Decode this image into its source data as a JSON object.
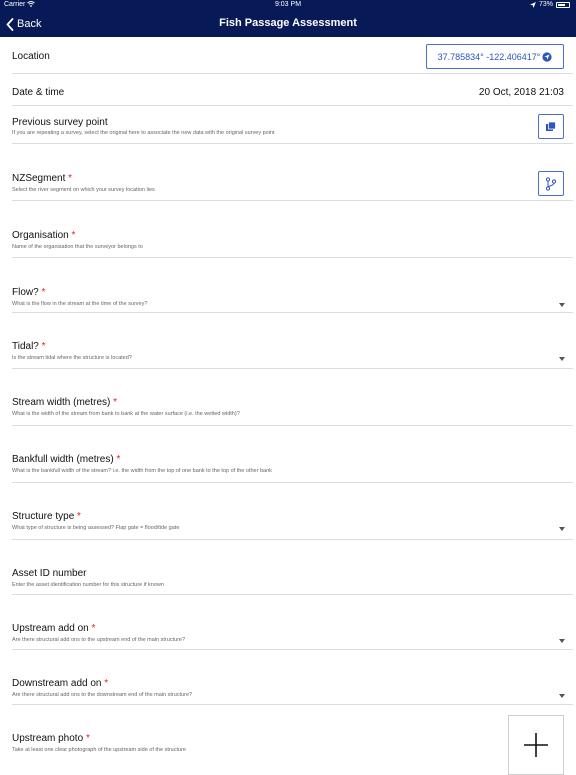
{
  "status_bar": {
    "carrier": "Carrier",
    "time": "9:03 PM",
    "battery": "73%"
  },
  "nav": {
    "back_label": "Back",
    "title": "Fish Passage Assessment"
  },
  "required_marker": "*",
  "fields": {
    "location": {
      "label": "Location",
      "value": "37.785834° -122.406417°"
    },
    "datetime": {
      "label": "Date & time",
      "value": "20 Oct, 2018 21:03"
    },
    "previous_survey": {
      "label": "Previous survey point",
      "help": "If you are repeating a survey, select the original here to associate the new data with the original survey point"
    },
    "nzsegment": {
      "label": "NZSegment",
      "help": "Select the river segment on which your survey location lies"
    },
    "organisation": {
      "label": "Organisation",
      "help": "Name of the organisation that the surveyor belongs to"
    },
    "flow": {
      "label": "Flow?",
      "help": "What is the flow in the stream at the time of the survey?"
    },
    "tidal": {
      "label": "Tidal?",
      "help": "Is the stream tidal where the structure is located?"
    },
    "stream_width": {
      "label": "Stream width (metres)",
      "help": "What is the width of the stream from bank to bank at the water surface (i.e. the wetted width)?"
    },
    "bankfull_width": {
      "label": "Bankfull width (metres)",
      "help": "What is the bankfull width of the stream? i.e. the width from the top of one bank to the top of the other bank"
    },
    "structure_type": {
      "label": "Structure type",
      "help": "What type of structure is being assessed? Flap gate = flood/tide gate"
    },
    "asset_id": {
      "label": "Asset ID number",
      "help": "Enter the asset identification number for this structure if known"
    },
    "upstream_addon": {
      "label": "Upstream add on",
      "help": "Are there structural add ons to the upstream end of the main structure?"
    },
    "downstream_addon": {
      "label": "Downstream add on",
      "help": "Are there structural add ons to the downstream end of the main structure?"
    },
    "upstream_photo": {
      "label": "Upstream photo",
      "help": "Take at least one clear photograph of the upstream side of the structure"
    }
  },
  "colors": {
    "nav_bg": "#071a57",
    "accent": "#2c55c0",
    "required": "#e02020"
  }
}
